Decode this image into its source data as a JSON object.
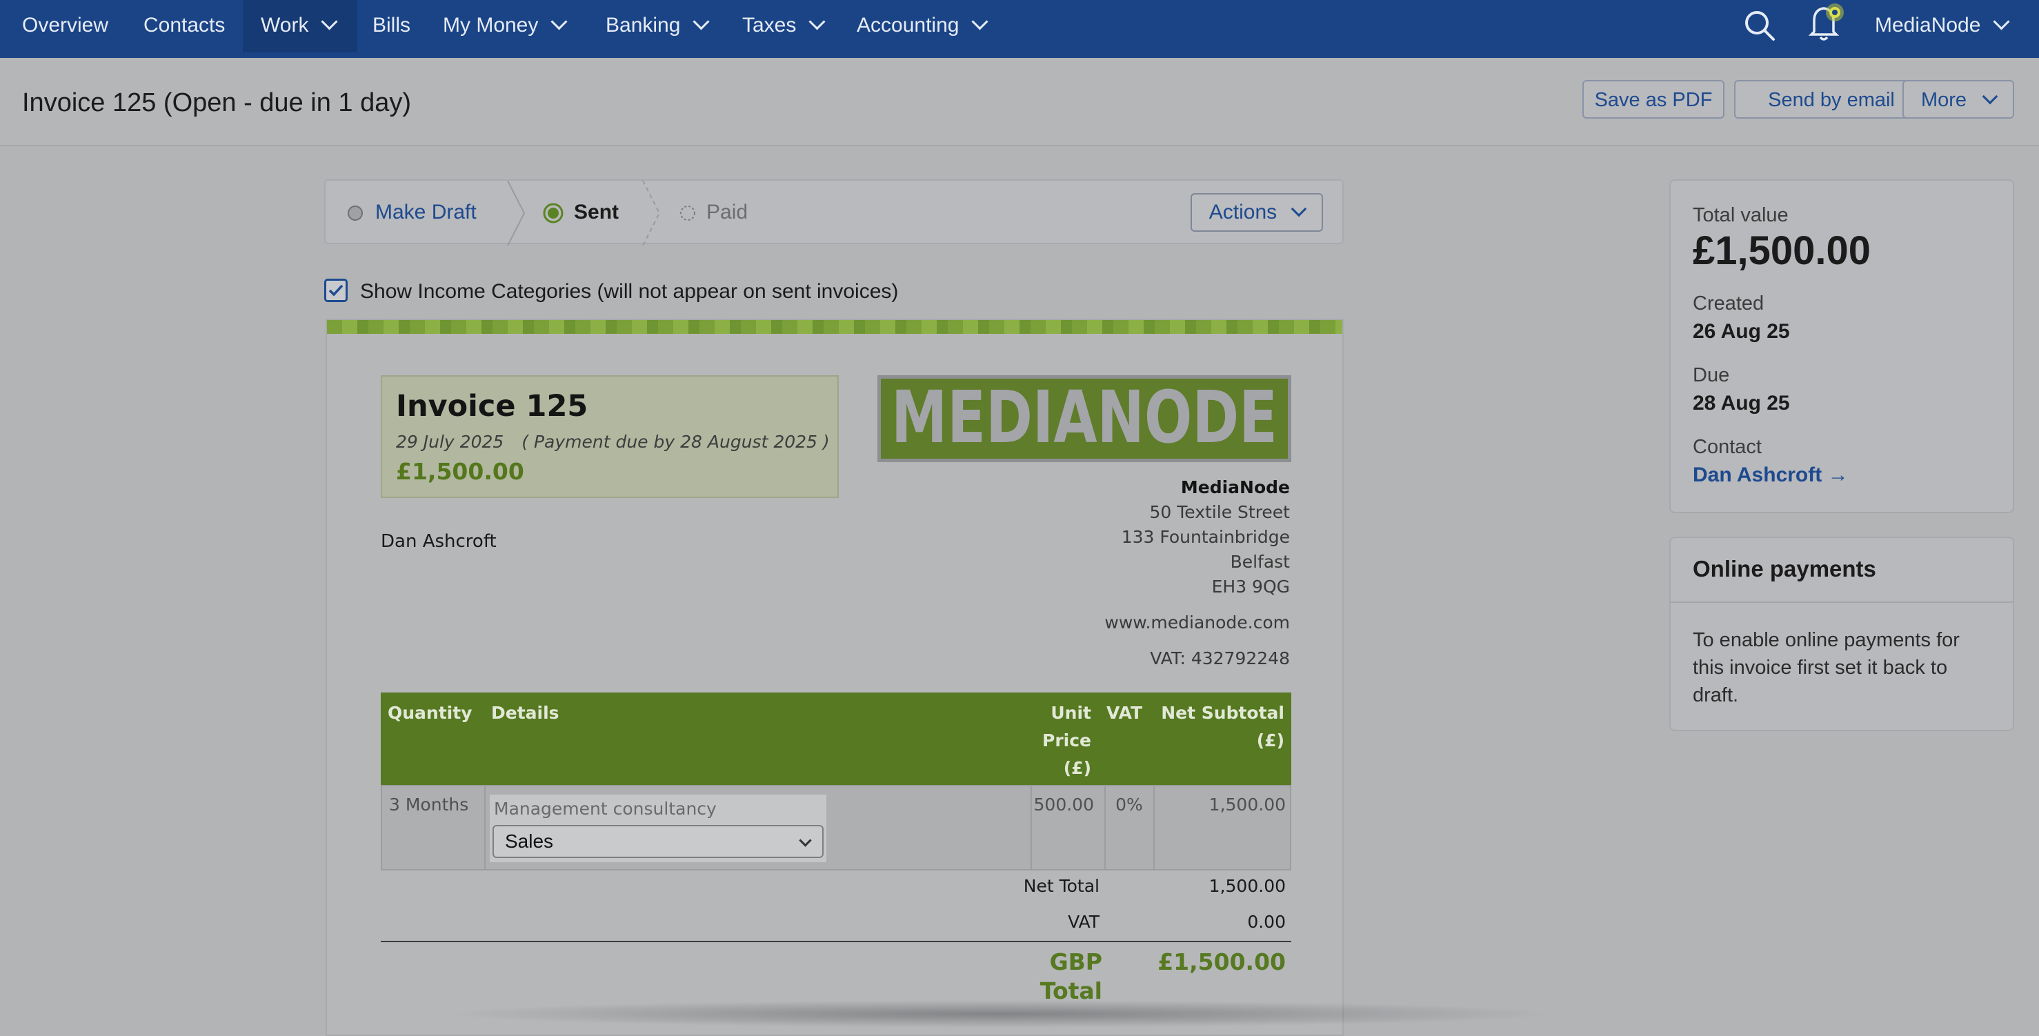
{
  "nav": {
    "items": [
      {
        "label": "Overview"
      },
      {
        "label": "Contacts"
      },
      {
        "label": "Work"
      },
      {
        "label": "Bills"
      },
      {
        "label": "My Money"
      },
      {
        "label": "Banking"
      },
      {
        "label": "Taxes"
      },
      {
        "label": "Accounting"
      }
    ],
    "account": "MediaNode"
  },
  "header": {
    "title": "Invoice 125 (Open - due in 1 day)",
    "save_pdf": "Save as PDF",
    "send_email": "Send by email",
    "more": "More"
  },
  "status": {
    "make_draft": "Make Draft",
    "sent": "Sent",
    "paid": "Paid",
    "actions": "Actions"
  },
  "show_categories": {
    "label": "Show Income Categories (will not appear on sent invoices)",
    "checked": true
  },
  "invoice": {
    "title": "Invoice 125",
    "date": "29 July 2025",
    "due_note": "( Payment due by 28 August 2025 )",
    "amount": "£1,500.00",
    "logo_text": "MEDIANODE",
    "client": "Dan Ashcroft",
    "company": {
      "name": "MediaNode",
      "line1": "50 Textile Street",
      "line2": "133 Fountainbridge",
      "city": "Belfast",
      "postcode": "EH3 9QG",
      "website": "www.medianode.com",
      "vat": "VAT: 432792248"
    },
    "table": {
      "headers": {
        "quantity": "Quantity",
        "details": "Details",
        "unit_price_1": "Unit",
        "unit_price_2": "Price",
        "unit_price_3": "(£)",
        "vat": "VAT",
        "net_1": "Net Subtotal",
        "net_2": "(£)"
      },
      "rows": [
        {
          "quantity": "3 Months",
          "details": "Management consultancy",
          "category": "Sales",
          "unit_price": "500.00",
          "vat": "0%",
          "net": "1,500.00"
        }
      ]
    },
    "totals": {
      "net_label": "Net Total",
      "net_value": "1,500.00",
      "vat_label": "VAT",
      "vat_value": "0.00",
      "total_label_1": "GBP",
      "total_label_2": "Total",
      "total_value": "£1,500.00"
    }
  },
  "summary": {
    "total_label": "Total value",
    "total_value": "£1,500.00",
    "created_label": "Created",
    "created_value": "26 Aug 25",
    "due_label": "Due",
    "due_value": "28 Aug 25",
    "contact_label": "Contact",
    "contact_value": "Dan Ashcroft →"
  },
  "online_payments": {
    "title": "Online payments",
    "text": "To enable online payments for this invoice first set it back to draft."
  }
}
